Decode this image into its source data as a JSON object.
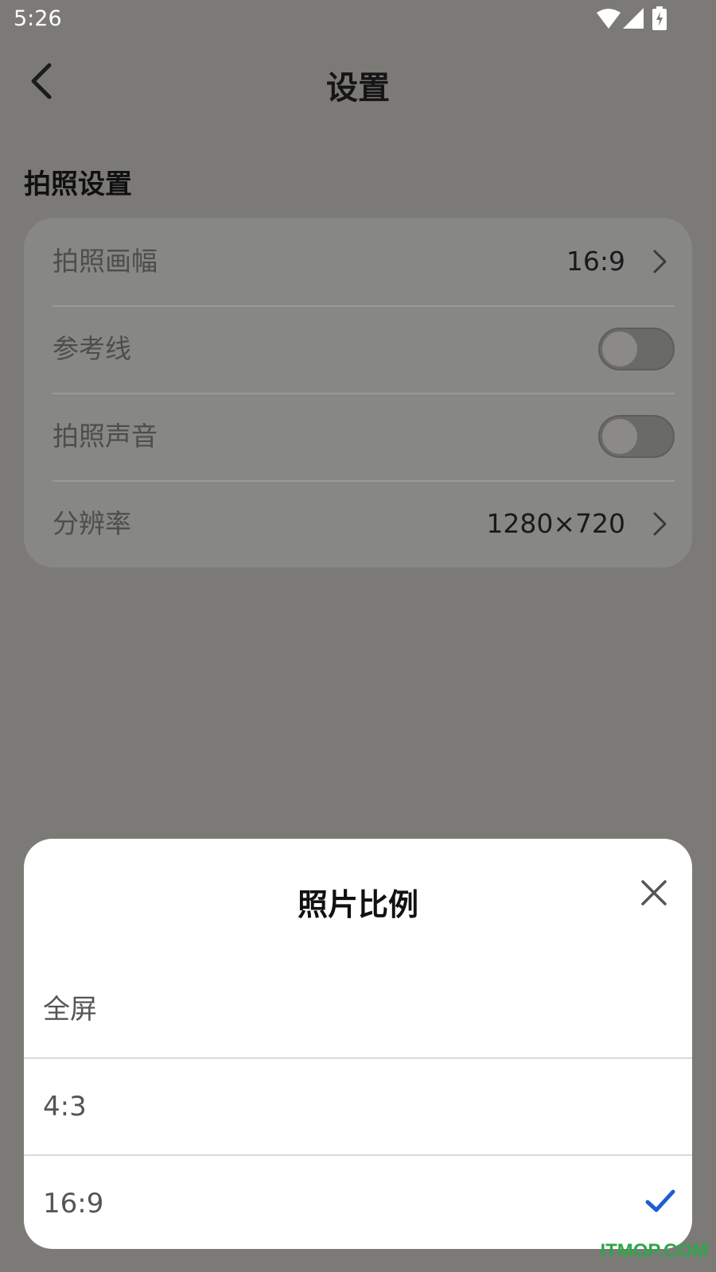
{
  "status_bar": {
    "time": "5:26"
  },
  "header": {
    "title": "设置"
  },
  "section": {
    "title": "拍照设置"
  },
  "settings": {
    "frame_label": "拍照画幅",
    "frame_value": "16:9",
    "grid_label": "参考线",
    "grid_on": false,
    "sound_label": "拍照声音",
    "sound_on": false,
    "resolution_label": "分辨率",
    "resolution_value": "1280×720"
  },
  "sheet": {
    "title": "照片比例",
    "options": [
      {
        "label": "全屏",
        "selected": false
      },
      {
        "label": "4:3",
        "selected": false
      },
      {
        "label": "16:9",
        "selected": true
      }
    ],
    "accent_color": "#1d5fd1"
  },
  "watermark": "ITMOP.COM"
}
